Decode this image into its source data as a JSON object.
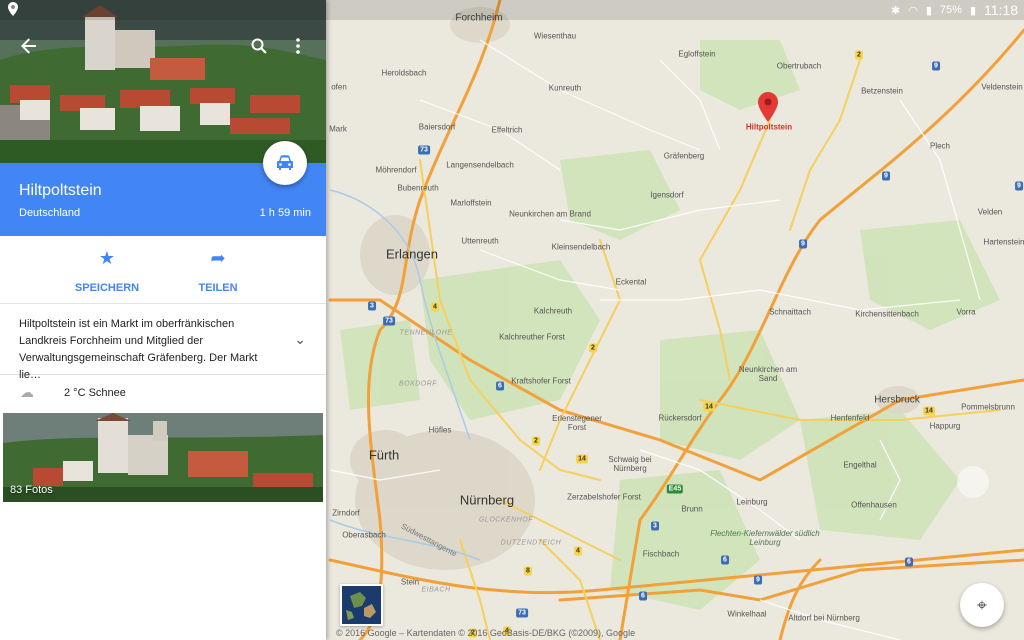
{
  "status_bar": {
    "battery": "75%",
    "time": "11:18",
    "icons": [
      "location-icon",
      "bluetooth-icon",
      "wifi-icon",
      "signal-icon",
      "battery-icon"
    ]
  },
  "place_panel": {
    "title": "Hiltpoltstein",
    "country": "Deutschland",
    "duration": "1 h 59 min",
    "actions": {
      "save_label": "SPEICHERN",
      "share_label": "TEILEN"
    },
    "description": "Hiltpoltstein ist ein Markt im oberfränkischen Landkreis Forchheim und Mitglied der Verwaltungsgemeinschaft Gräfenberg. Der Markt lie…",
    "weather": "2 °C Schnee",
    "photos_count": "83 Fotos",
    "accent_color": "#4285f4"
  },
  "map": {
    "destination": "Hiltpoltstein",
    "cities": [
      "Erlangen",
      "Fürth",
      "Nürnberg"
    ],
    "towns": [
      "Forchheim",
      "Hersbruck"
    ],
    "places": [
      "Wiesenthau",
      "Egloffstein",
      "Obertrubach",
      "Betzenstein",
      "Veldenstein",
      "Heroldsbach",
      "Kunreuth",
      "Baiersdorf",
      "Effeltrich",
      "Gräfenberg",
      "Plech",
      "Möhrendorf",
      "Langensendelbach",
      "Bubenreuth",
      "Marloffstein",
      "Igensdorf",
      "Velden",
      "Neunkirchen am Brand",
      "Kleinsendelbach",
      "Uttenreuth",
      "Hartenstein",
      "Eckental",
      "Kalchreuth",
      "Schnaittach",
      "Kirchensittenbach",
      "Vorra",
      "Kalchreuther Forst",
      "Neunkirchen am Sand",
      "Kraftshofer Forst",
      "Erlenstegener Forst",
      "Rückersdorf",
      "Henfenfeld",
      "Pommelsbrunn",
      "Happurg",
      "Höfles",
      "Schwaig bei Nürnberg",
      "Engelthal",
      "Zerzabelshofer Forst",
      "Offenhausen",
      "Zirndorf",
      "Brunn",
      "Leinburg",
      "Oberasbach",
      "Fischbach",
      "Stein",
      "Winkelhaal",
      "Altdorf bei Nürnberg",
      "ofen",
      "Mark"
    ],
    "forests": [
      "Flechten-Kiefernwälder südlich Leinburg"
    ],
    "districts": [
      "TENNENLOHE",
      "BOXDORF",
      "GLOCKENHOF",
      "DUTZENDTEICH",
      "EIBACH"
    ],
    "road_labels": [
      "Südwesttangente"
    ],
    "shields": {
      "blue": [
        "9",
        "73",
        "3",
        "73",
        "9",
        "9",
        "9",
        "3",
        "6",
        "6",
        "9",
        "6",
        "6",
        "73"
      ],
      "yellow": [
        "2",
        "4",
        "2",
        "14",
        "14",
        "2",
        "14",
        "4",
        "8",
        "2",
        "4"
      ],
      "green": [
        "E45"
      ]
    },
    "copyright": "© 2016 Google – Kartendaten © 2016 GeoBasis-DE/BKG (©2009), Google"
  }
}
